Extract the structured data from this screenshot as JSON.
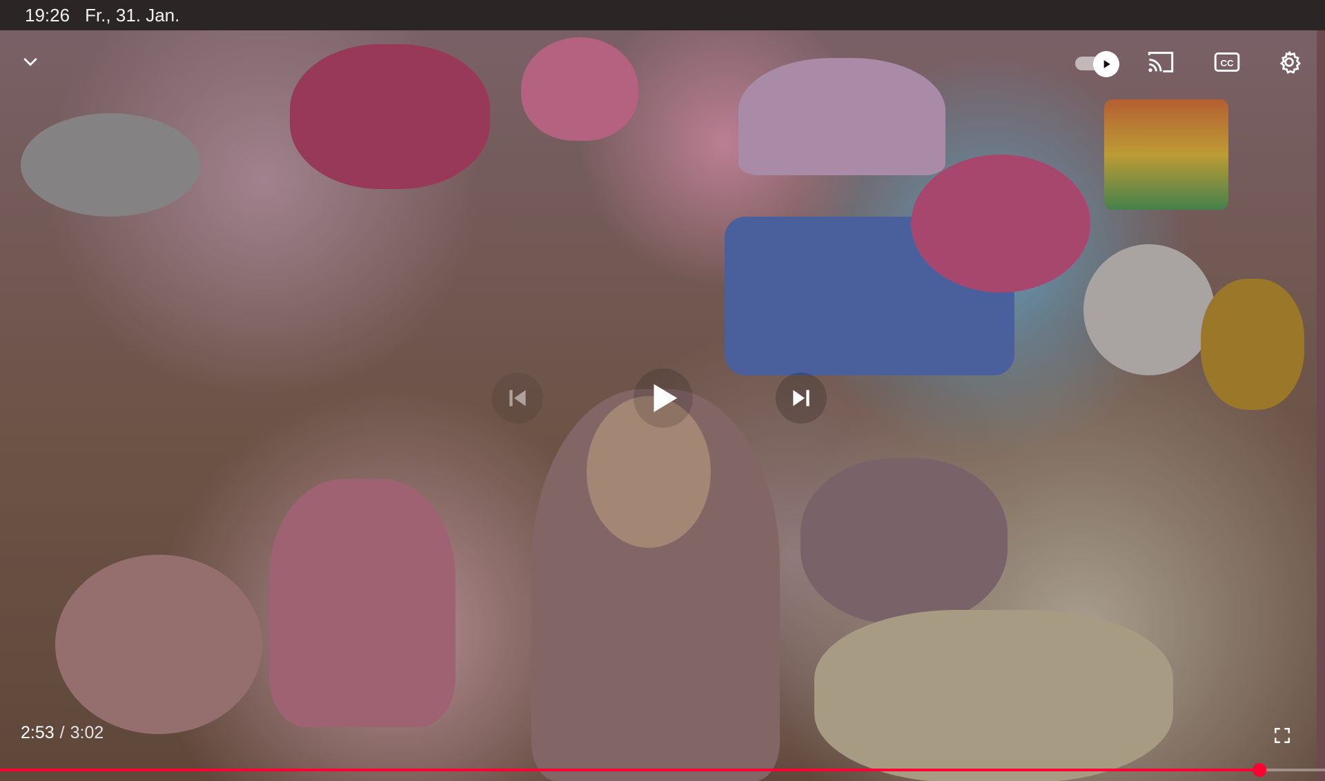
{
  "status_bar": {
    "time": "19:26",
    "date": "Fr., 31. Jan."
  },
  "player": {
    "current_time": "2:53",
    "separator": "/",
    "duration": "3:02",
    "progress_fraction": 0.9505,
    "autoplay_on": true,
    "controls": {
      "collapse_icon": "chevron-down-icon",
      "autoplay_icon": "play-icon",
      "cast_icon": "cast-icon",
      "cc_icon": "cc-icon",
      "settings_icon": "gear-icon",
      "previous_icon": "skip-previous-icon",
      "play_icon": "play-icon",
      "next_icon": "skip-next-icon",
      "fullscreen_icon": "fullscreen-icon"
    },
    "accent_color": "#ff0033"
  }
}
